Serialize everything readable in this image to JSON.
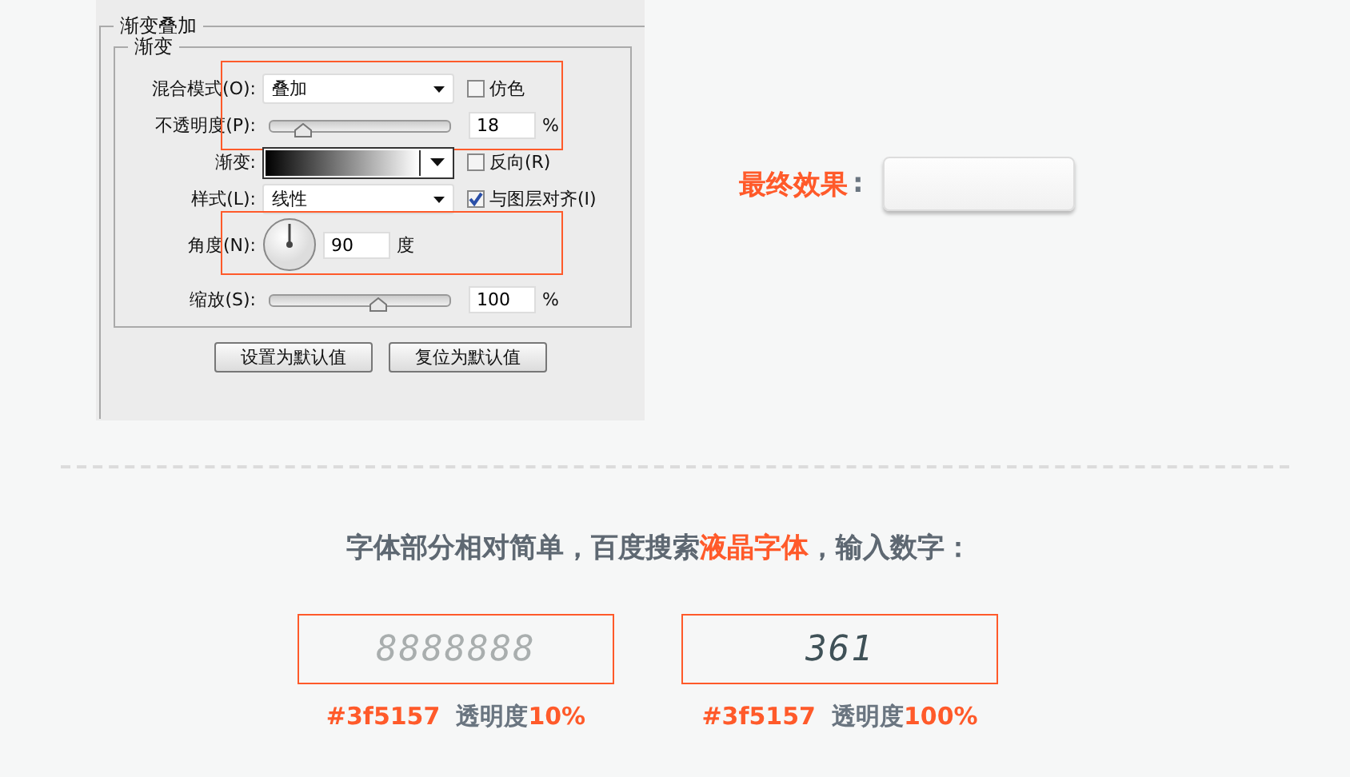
{
  "panel": {
    "title": "渐变叠加",
    "group_title": "渐变",
    "rows": [
      {
        "kind": "select",
        "label": "混合模式(O):",
        "value": "叠加",
        "checkbox": {
          "label": "仿色",
          "checked": false
        },
        "highlighted": true
      },
      {
        "kind": "slider",
        "label": "不透明度(P):",
        "level": 0.18,
        "value": "18",
        "unit": "%",
        "highlighted": true
      },
      {
        "kind": "gradient",
        "label": "渐变:",
        "checkbox": {
          "label": "反向(R)",
          "checked": false
        },
        "highlighted": false
      },
      {
        "kind": "select",
        "label": "样式(L):",
        "value": "线性",
        "checkbox": {
          "label": "与图层对齐(I)",
          "checked": true
        },
        "highlighted": false
      },
      {
        "kind": "angle",
        "label": "角度(N):",
        "value": "90",
        "unit": "度",
        "highlighted": true
      },
      {
        "kind": "slider",
        "label": "缩放(S):",
        "level": 0.6,
        "value": "100",
        "unit": "%",
        "highlighted": false
      }
    ],
    "buttons": [
      "设置为默认值",
      "复位为默认值"
    ]
  },
  "result": {
    "label": "最终效果",
    "colon": ":"
  },
  "heading": [
    {
      "text": "字体部分相对简单，百度搜索",
      "highlight": false
    },
    {
      "text": "液晶字体",
      "highlight": true
    },
    {
      "text": "，输入数字：",
      "highlight": false
    }
  ],
  "samples": [
    {
      "display": "8888888",
      "kind": "ghost",
      "caption": [
        {
          "text": "#3f5157",
          "highlight": true
        },
        {
          "text": "透明度",
          "highlight": false
        },
        {
          "text": "10%",
          "highlight": true
        }
      ]
    },
    {
      "display": "361",
      "kind": "solid",
      "caption": [
        {
          "text": "#3f5157",
          "highlight": true
        },
        {
          "text": "透明度",
          "highlight": false
        },
        {
          "text": "100%",
          "highlight": true
        }
      ]
    }
  ]
}
